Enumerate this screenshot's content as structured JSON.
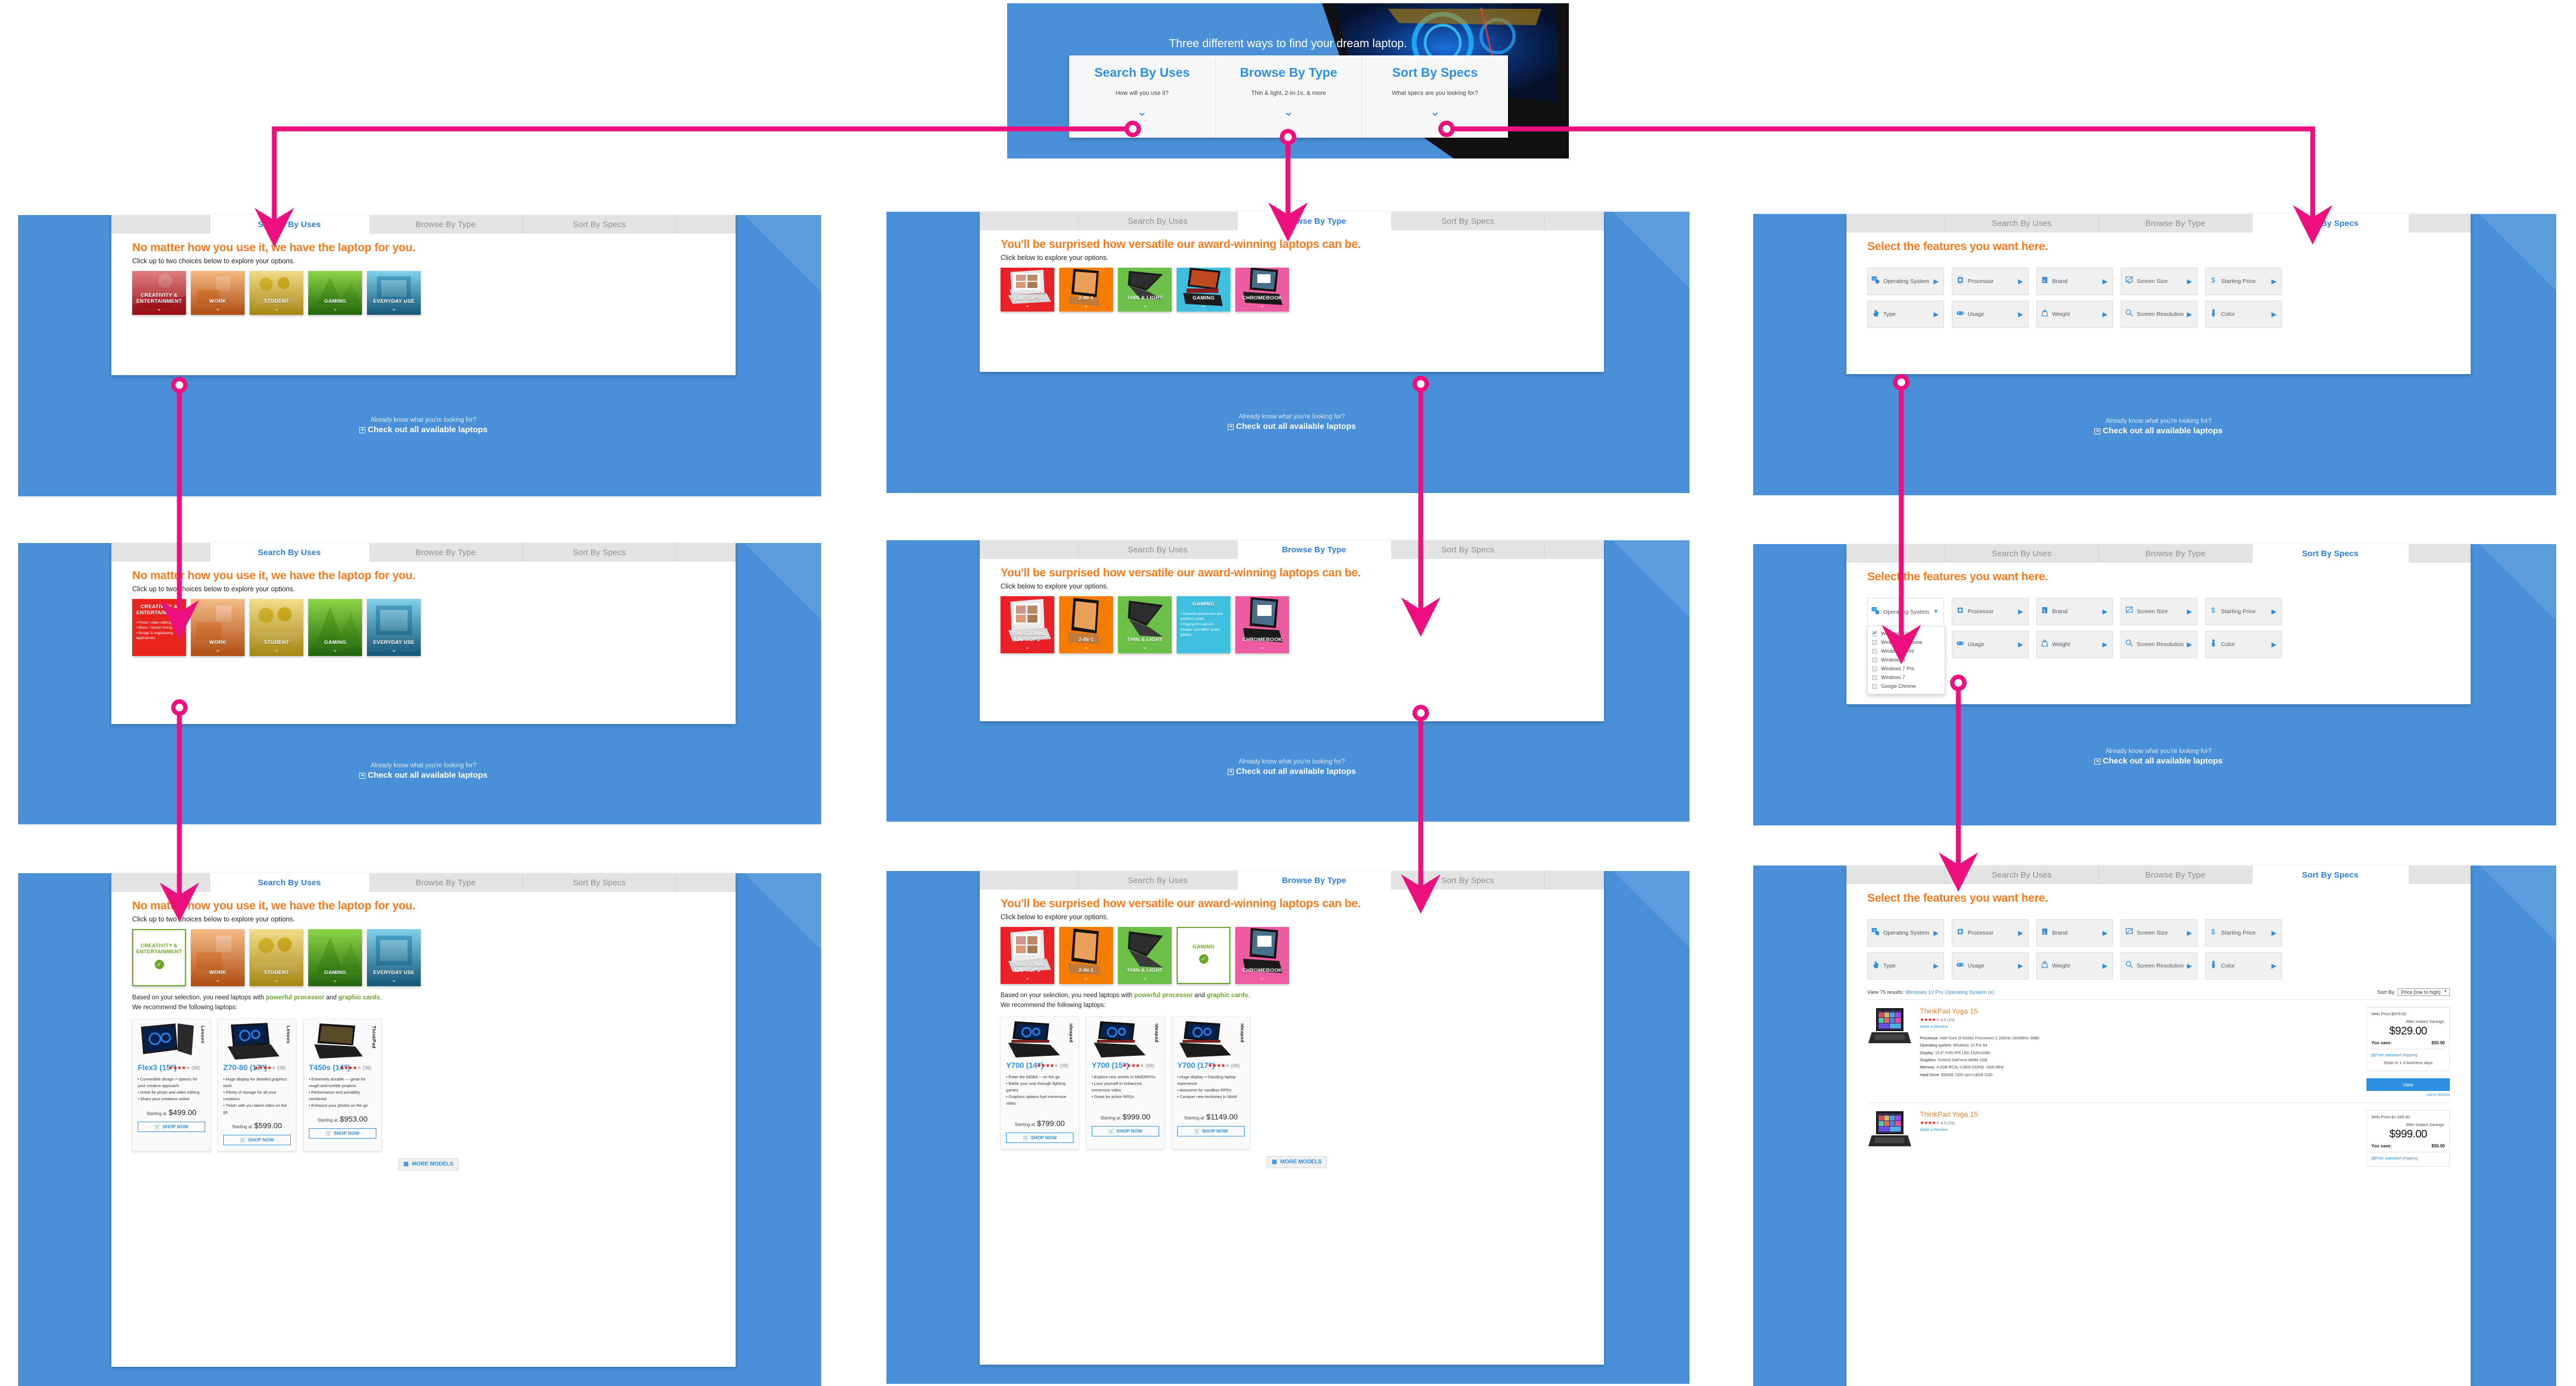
{
  "colors": {
    "accent_blue": "#2d8fe0",
    "panel_blue": "#4a90d9",
    "orange_heading": "#f47b20",
    "green": "#6aa62a",
    "connector_pink": "#ee0f7f"
  },
  "hero": {
    "title": "Three different ways to find your dream laptop.",
    "cards": [
      {
        "title": "Search By Uses",
        "subtitle": "How will you use it?",
        "chevron": "chevron-down"
      },
      {
        "title": "Browse By Type",
        "subtitle": "Thin & light, 2-in-1s, & more",
        "chevron": "chevron-down"
      },
      {
        "title": "Sort By Specs",
        "subtitle": "What specs are you looking for?",
        "chevron": "chevron-down"
      }
    ]
  },
  "tabs": [
    "Search By Uses",
    "Browse By Type",
    "Sort By Specs"
  ],
  "already": {
    "line1": "Already know what you're looking for?",
    "line2": "Check out all available laptops"
  },
  "uses_panel": {
    "heading": "No matter how you use it, we have the laptop for you.",
    "sub": "Click up to two choices below to explore your options.",
    "tiles": [
      {
        "label": "CREATIVITY &\nENTERTAINMENT",
        "color": "#c4161c"
      },
      {
        "label": "WORK",
        "color": "#d8690f"
      },
      {
        "label": "STUDENT",
        "color": "#c9a40c"
      },
      {
        "label": "GAMING",
        "color": "#2d7d12"
      },
      {
        "label": "EVERYDAY USE",
        "color": "#1c6a92"
      }
    ],
    "expanded_tile_bullets": [
      "Photo / video editing",
      "Music / sound mixing",
      "Design & engineering applications"
    ]
  },
  "type_panel": {
    "heading": "You'll be surprised how versatile our award-winning laptops can be.",
    "sub": "Click below to explore your options.",
    "tiles": [
      {
        "label": "TRADITIONAL\nLAPTOPS",
        "color": "#ea2227"
      },
      {
        "label": "2-IN-1",
        "color": "#f57c00"
      },
      {
        "label": "THIN & LIGHT",
        "color": "#6cc04a"
      },
      {
        "label": "GAMING",
        "color": "#3fbfdf"
      },
      {
        "label": "CHROMEBOOK",
        "color": "#ef5ba1"
      }
    ],
    "expanded_tile_bullets": [
      "Powerful processors and graphics cards",
      "Playing first-person-shooter and MMO action games"
    ]
  },
  "specs_panel": {
    "heading": "Select the features you want here.",
    "features": [
      {
        "label": "Operating System",
        "icon": "os-icon"
      },
      {
        "label": "Processor",
        "icon": "cpu-icon"
      },
      {
        "label": "Brand",
        "icon": "lenovo-logo-icon"
      },
      {
        "label": "Screen Size",
        "icon": "monitor-icon"
      },
      {
        "label": "Starting Price",
        "icon": "dollar-icon"
      },
      {
        "label": "Type",
        "icon": "hand-pointer-icon"
      },
      {
        "label": "Usage",
        "icon": "gamepad-icon"
      },
      {
        "label": "Weight",
        "icon": "weight-icon"
      },
      {
        "label": "Screen Resolution",
        "icon": "magnifier-icon"
      },
      {
        "label": "Color",
        "icon": "paintbrush-icon"
      }
    ],
    "os_dropdown": {
      "options": [
        {
          "label": "Windows 10 Pro",
          "checked": true
        },
        {
          "label": "Windows 10 Home",
          "checked": false
        },
        {
          "label": "Windows 8 Pro",
          "checked": false
        },
        {
          "label": "Windows 8",
          "checked": false
        },
        {
          "label": "Windows 7 Pro",
          "checked": false
        },
        {
          "label": "Windows 7",
          "checked": false
        },
        {
          "label": "Google Chrome",
          "checked": false
        }
      ]
    }
  },
  "recommend": {
    "line1_prefix": "Based on your selection, you need laptops with ",
    "line1_g1": "powerful processor",
    "line1_mid": " and ",
    "line1_g2": "graphic cards",
    "line1_suffix": ".",
    "line2": "We recommend the following laptops:",
    "more_models": "MORE MODELS",
    "shop_now": "SHOP NOW",
    "starting_at": "Starting at"
  },
  "creativity_products": [
    {
      "name": "Flex3 (15\")",
      "brand": "Lenovo",
      "rating_count": "(98)",
      "stars": 4,
      "features": [
        "Convertible design = options for your creative approach",
        "Great for photo and video editing",
        "Share your creations online"
      ],
      "price": "$499.00"
    },
    {
      "name": "Z70-80 (17\")",
      "brand": "Lenovo",
      "rating_count": "(98)",
      "stars": 4,
      "features": [
        "Huge display for detailed graphics work",
        "Plenty of storage for all your creations",
        "Tinker with you latest video on the go"
      ],
      "price": "$599.00"
    },
    {
      "name": "T450s (14\")",
      "brand": "ThinkPad",
      "rating_count": "(98)",
      "stars": 4,
      "features": [
        "Extremely durable — great for rough-and-tumble projects",
        "Performance and portablity combined",
        "Enhance your photos on the go"
      ],
      "price": "$953.00"
    }
  ],
  "gaming_products": [
    {
      "name": "Y700 (14\")",
      "brand": "ideapad",
      "rating_count": "(98)",
      "stars": 4,
      "features": [
        "Enter the MOBA -- on the go",
        "Battle your way through fighting games",
        "Graphics options fuel immersive video"
      ],
      "price": "$799.00"
    },
    {
      "name": "Y700 (15\")",
      "brand": "ideapad",
      "rating_count": "(98)",
      "stars": 4,
      "features": [
        "Explore new worlds in MMORPGs",
        "Lose yourself in enhanced, immersive video",
        "Great for action RPGs"
      ],
      "price": "$999.00"
    },
    {
      "name": "Y700 (17\")",
      "brand": "ideapad",
      "rating_count": "(98)",
      "stars": 4,
      "features": [
        "Huge display = Dazzling laptop experience",
        "Awesome for sandbox RPGs",
        "Conquer new territories in WoW"
      ],
      "price": "$1149.00"
    }
  ],
  "results": {
    "view_prefix": "View 75 results: ",
    "filter_chip": "Windows 10 Pro Operating System (x)",
    "sort_label": "Sort By",
    "sort_value": "Price (low to high)",
    "items": [
      {
        "title": "ThinkPad Yoga 15",
        "rating_value": "4.5",
        "rating_count": "(15)",
        "write_review": "Write a Review",
        "specs": [
          {
            "k": "Processor:",
            "v": "Intel Core i5-5200U Processor( 2.20GHz 1600MHz 3MB)"
          },
          {
            "k": "Operating system:",
            "v": "Windows 10 Pro 64"
          },
          {
            "k": "Display:",
            "v": "15.6\" FHD IPS LED 1920x1080"
          },
          {
            "k": "Graphics:",
            "v": "NVIDIA GeForce 840M 2GB"
          },
          {
            "k": "Memory:",
            "v": "4.0GB PC3L-12800 DDR3L 1600 MHz"
          },
          {
            "k": "Hard Drive:",
            "v": "500GB 7200 rpm+16GB SSD"
          }
        ],
        "web_price": "Web Price:$979.00",
        "after_savings": "After Instant Savings:",
        "big_price": "$929.00",
        "save_label": "You save:",
        "save_value": "$50.00",
        "shipping": "Free standard shipping",
        "ships_in": "Ships in 1-3 business days",
        "view_button": "View",
        "wishlist": "Add to Wishlist"
      },
      {
        "title": "ThinkPad Yoga 15",
        "rating_value": "4.5",
        "rating_count": "(15)",
        "write_review": "Write a Review",
        "specs": [],
        "web_price": "Web Price:$1,049.00",
        "after_savings": "After Instant Savings:",
        "big_price": "$999.00",
        "save_label": "You save:",
        "save_value": "$50.00",
        "shipping": "Free standard shipping",
        "ships_in": "",
        "view_button": "",
        "wishlist": ""
      }
    ]
  }
}
